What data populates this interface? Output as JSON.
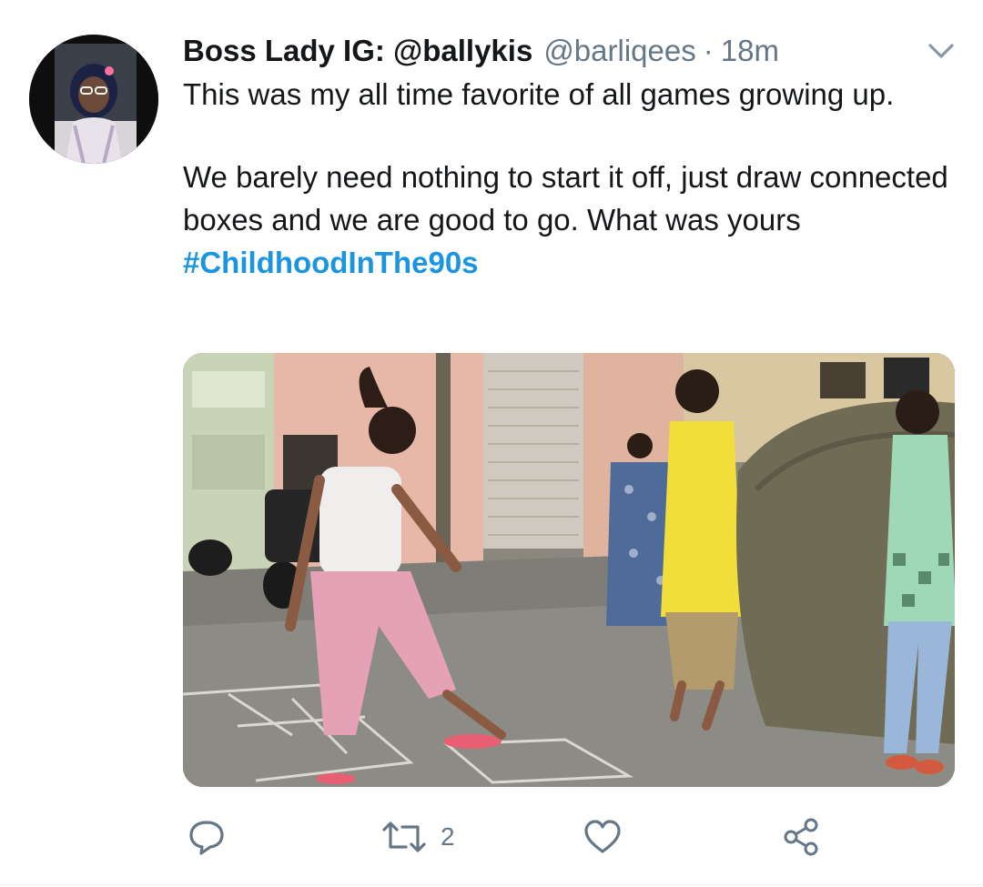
{
  "tweet": {
    "display_name": "Boss Lady IG: @ballykis",
    "handle": "@barliqees",
    "separator": "·",
    "time": "18m",
    "text_line1": "This was my all time favorite of all games growing up.",
    "text_para2": "We barely need nothing to start it off, just draw connected boxes and we are good to go. What was yours",
    "hashtag": "#ChildhoodInThe90s"
  },
  "actions": {
    "reply_icon": "reply-icon",
    "retweet_icon": "retweet-icon",
    "retweet_count": "2",
    "like_icon": "heart-icon",
    "share_icon": "share-icon"
  },
  "colors": {
    "link": "#1b95e0",
    "secondary": "#657786",
    "text": "#14171a"
  }
}
